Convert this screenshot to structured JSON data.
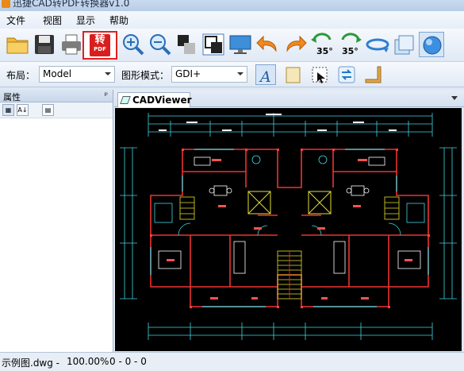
{
  "window": {
    "title": "迅捷CAD转PDF转换器v1.0"
  },
  "menu": [
    "文件",
    "视图",
    "显示",
    "帮助"
  ],
  "toolbar": {
    "pdf_button": {
      "zh": "转",
      "en": "PDF"
    },
    "rotate_left_label": "35°",
    "rotate_right_label": "35°"
  },
  "layout_bar": {
    "layout_label": "布局：",
    "layout_value": "Model",
    "graphics_label": "图形模式：",
    "graphics_value": "GDI+"
  },
  "properties_panel": {
    "title": "属性",
    "pin": "ᵖ"
  },
  "viewer": {
    "tab_label": "CADViewer"
  },
  "status": {
    "file": "示例图.dwg -",
    "zoom": "100.00%",
    "coords": "0 - 0 - 0"
  },
  "colors": {
    "canvas_bg": "#000000",
    "accent_red": "#e12020"
  }
}
